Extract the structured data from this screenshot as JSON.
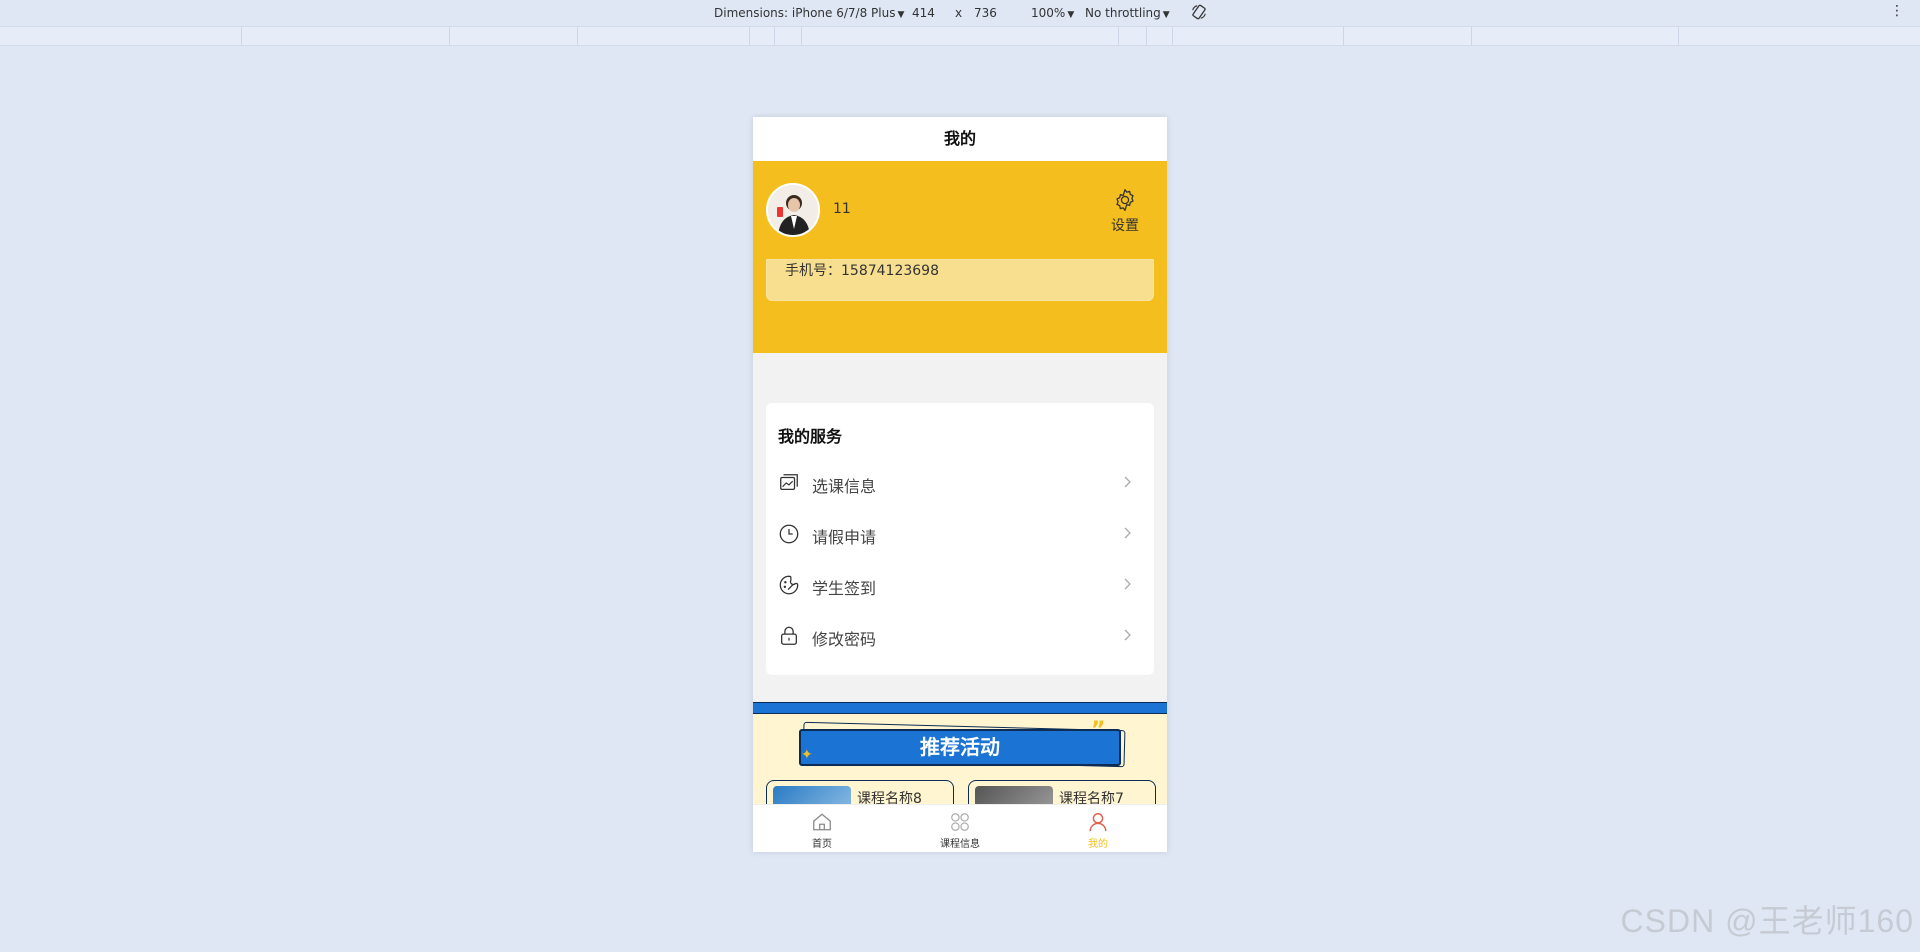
{
  "devtools": {
    "dimensions_label": "Dimensions: iPhone 6/7/8 Plus",
    "width": "414",
    "times": "x",
    "height": "736",
    "zoom": "100%",
    "throttling": "No throttling",
    "more": "⋮"
  },
  "page": {
    "title": "我的"
  },
  "profile": {
    "username": "11",
    "settings_label": "设置",
    "phone_label": "手机号：15874123698"
  },
  "services": {
    "title": "我的服务",
    "items": [
      {
        "label": "选课信息",
        "icon": "image-card-icon"
      },
      {
        "label": "请假申请",
        "icon": "clock-icon"
      },
      {
        "label": "学生签到",
        "icon": "palette-icon"
      },
      {
        "label": "修改密码",
        "icon": "lock-icon"
      }
    ]
  },
  "promo": {
    "title": "推荐活动",
    "courses": [
      {
        "name": "课程名称8"
      },
      {
        "name": "课程名称7"
      }
    ]
  },
  "tabbar": {
    "items": [
      {
        "label": "首页",
        "icon": "home-icon",
        "active": false
      },
      {
        "label": "课程信息",
        "icon": "grid-icon",
        "active": false
      },
      {
        "label": "我的",
        "icon": "user-icon",
        "active": true
      }
    ]
  },
  "watermark": "CSDN @王老师160",
  "colors": {
    "accent_yellow": "#f5be1f",
    "accent_blue": "#1b74d4",
    "page_bg": "#dfe7f5"
  }
}
